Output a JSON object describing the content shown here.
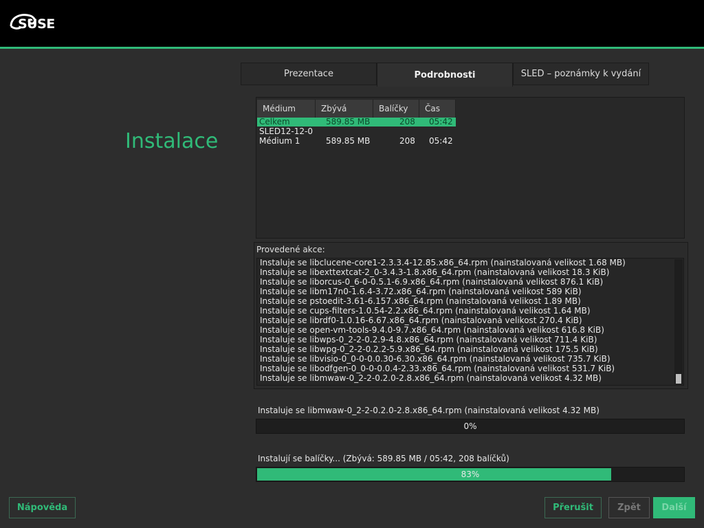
{
  "header": {
    "logo_text": "SUSE"
  },
  "page_title": "Instalace",
  "tabs": [
    {
      "label": "Prezentace",
      "active": false
    },
    {
      "label": "Podrobnosti",
      "active": true
    },
    {
      "label": "SLED – poznámky k vydání",
      "active": false
    }
  ],
  "media_table": {
    "columns": [
      "Médium",
      "Zbývá",
      "Balíčky",
      "Čas"
    ],
    "rows": [
      {
        "medium": "Celkem",
        "remaining": "589.85 MB",
        "packages": "208",
        "time": "05:42",
        "selected": true
      },
      {
        "medium": "SLED12-12-0",
        "remaining": "",
        "packages": "",
        "time": "",
        "selected": false
      },
      {
        "medium": "Médium 1",
        "remaining": "589.85 MB",
        "packages": "208",
        "time": "05:42",
        "selected": false
      }
    ]
  },
  "actions": {
    "label": "Provedené akce:",
    "log": [
      "Instaluje se libclucene-core1-2.3.3.4-12.85.x86_64.rpm (nainstalovaná velikost 1.68 MB)",
      "Instaluje se libexttextcat-2_0-3.4.3-1.8.x86_64.rpm (nainstalovaná velikost 18.3 KiB)",
      "Instaluje se liborcus-0_6-0-0.5.1-6.9.x86_64.rpm (nainstalovaná velikost 876.1 KiB)",
      "Instaluje se libm17n0-1.6.4-3.72.x86_64.rpm (nainstalovaná velikost 589 KiB)",
      "Instaluje se pstoedit-3.61-6.157.x86_64.rpm (nainstalovaná velikost 1.89 MB)",
      "Instaluje se cups-filters-1.0.54-2.2.x86_64.rpm (nainstalovaná velikost 1.64 MB)",
      "Instaluje se librdf0-1.0.16-6.67.x86_64.rpm (nainstalovaná velikost 270.4 KiB)",
      "Instaluje se open-vm-tools-9.4.0-9.7.x86_64.rpm (nainstalovaná velikost 616.8 KiB)",
      "Instaluje se libwps-0_2-2-0.2.9-4.8.x86_64.rpm (nainstalovaná velikost 711.4 KiB)",
      "Instaluje se libwpg-0_2-2-0.2.2-5.9.x86_64.rpm (nainstalovaná velikost 175.5 KiB)",
      "Instaluje se libvisio-0_0-0-0.0.30-6.30.x86_64.rpm (nainstalovaná velikost 735.7 KiB)",
      "Instaluje se libodfgen-0_0-0-0.0.4-2.33.x86_64.rpm (nainstalovaná velikost 531.7 KiB)",
      "Instaluje se libmwaw-0_2-2-0.2.0-2.8.x86_64.rpm (nainstalovaná velikost 4.32 MB)"
    ]
  },
  "package_progress": {
    "label": "Instaluje se libmwaw-0_2-2-0.2.0-2.8.x86_64.rpm (nainstalovaná velikost 4.32 MB)",
    "text": "0%",
    "fraction": 0.0
  },
  "total_progress": {
    "label": "Instalují se balíčky... (Zbývá: 589.85 MB / 05:42, 208 balíčků)",
    "text": "83%",
    "fraction": 0.83
  },
  "buttons": {
    "help": "Nápověda",
    "abort": "Přerušit",
    "back": "Zpět",
    "next": "Další"
  },
  "colors": {
    "accent": "#30ba78",
    "header_bg": "#000000",
    "bg": "#2d2d2d"
  }
}
